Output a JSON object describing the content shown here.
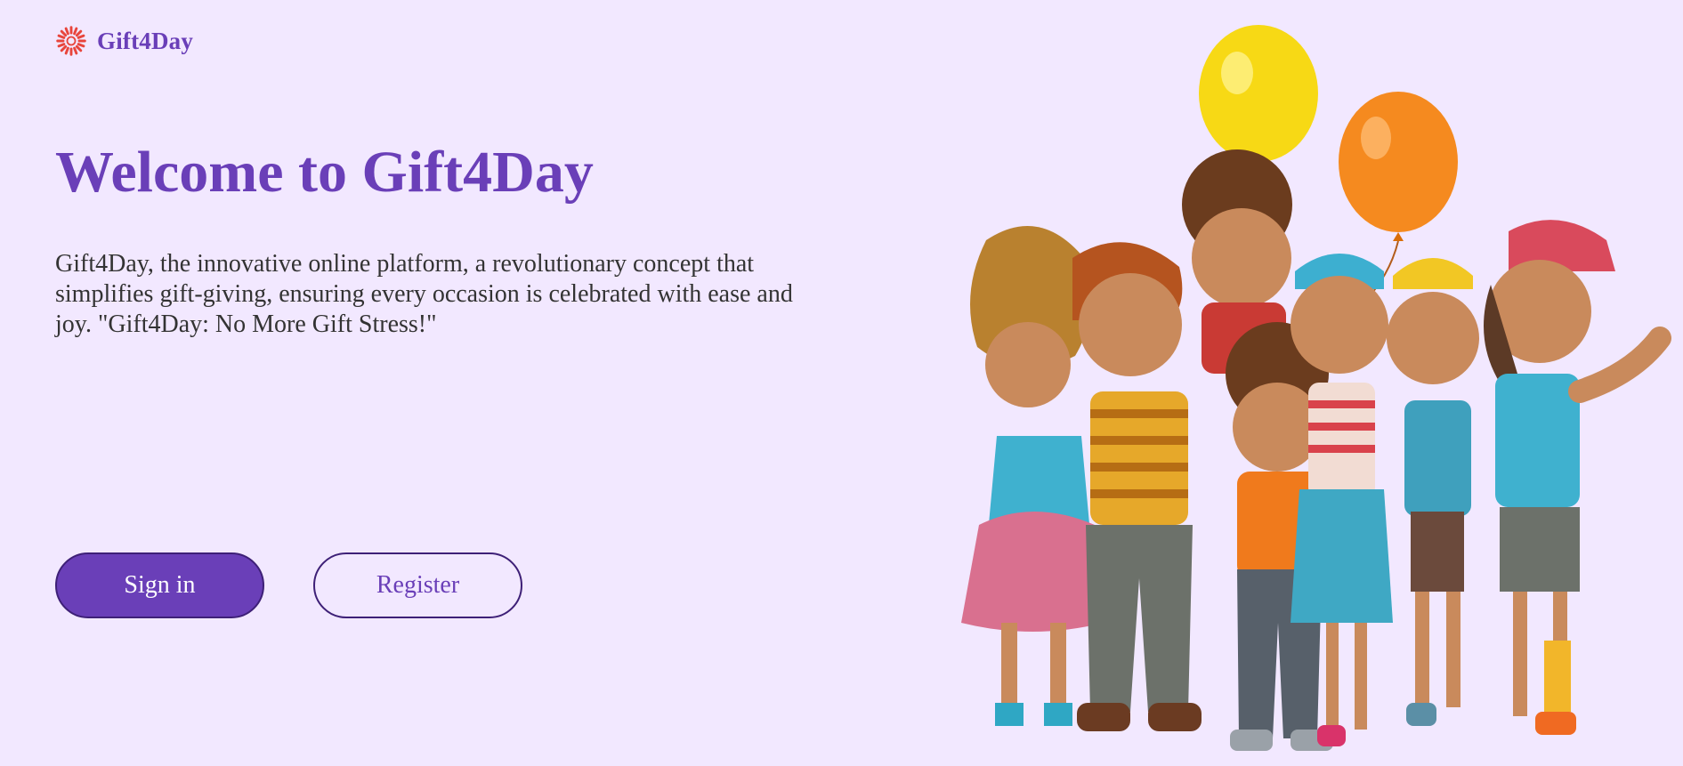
{
  "brand": {
    "name": "Gift4Day",
    "logo_icon": "sunburst-logo-icon",
    "logo_color": "#e8453c"
  },
  "hero": {
    "title": "Welcome to Gift4Day",
    "description": "Gift4Day, the innovative online platform, a revolutionary concept that simplifies gift-giving, ensuring every occasion is celebrated with ease and joy. \"Gift4Day: No More Gift Stress!\""
  },
  "actions": {
    "signin_label": "Sign in",
    "register_label": "Register"
  },
  "colors": {
    "background": "#f2e8ff",
    "accent": "#6a3fb8",
    "text": "#333333"
  },
  "illustration": {
    "subject": "group-of-kids-with-balloons"
  }
}
